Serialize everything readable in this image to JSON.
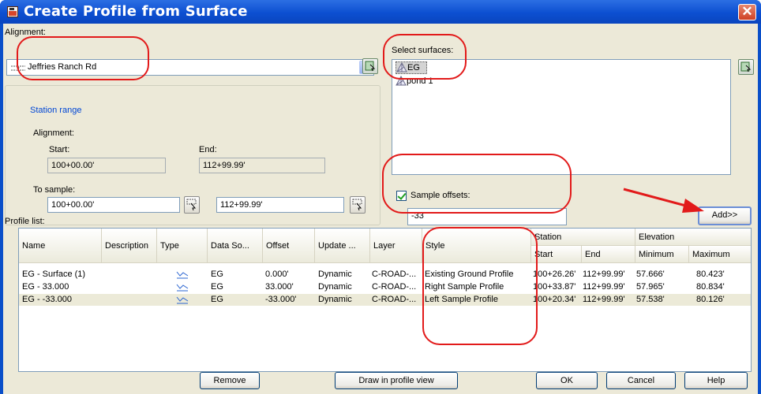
{
  "dialog": {
    "title": "Create Profile from Surface",
    "close_glyph": "✕"
  },
  "alignment": {
    "label": "Alignment:",
    "selected": "Jeffries Ranch Rd",
    "icon": "alignment-line-icon"
  },
  "station_range": {
    "title": "Station range",
    "alignment_label": "Alignment:",
    "start_label": "Start:",
    "end_label": "End:",
    "start_value": "100+00.00'",
    "end_value": "112+99.99'",
    "to_sample_label": "To sample:",
    "sample_start": "100+00.00'",
    "sample_end": "112+99.99'"
  },
  "surfaces": {
    "label": "Select surfaces:",
    "items": [
      {
        "name": "EG",
        "icon": "surface-icon",
        "selected": true
      },
      {
        "name": "pond 1",
        "icon": "surface-icon",
        "selected": false
      }
    ]
  },
  "sample_offsets": {
    "label": "Sample offsets:",
    "checked": true,
    "value": "-33"
  },
  "buttons": {
    "add": "Add>>",
    "remove": "Remove",
    "draw_in_profile_view": "Draw in profile view",
    "ok": "OK",
    "cancel": "Cancel",
    "help": "Help"
  },
  "profile_list": {
    "label": "Profile list:",
    "columns": {
      "name": "Name",
      "description": "Description",
      "type": "Type",
      "data_source": "Data So...",
      "offset": "Offset",
      "update": "Update ...",
      "layer": "Layer",
      "style": "Style",
      "station": "Station",
      "station_start": "Start",
      "station_end": "End",
      "elevation": "Elevation",
      "elevation_min": "Minimum",
      "elevation_max": "Maximum"
    },
    "rows": [
      {
        "name": "EG - Surface (1)",
        "description": "",
        "type_icon": "profile-type-icon",
        "data_source": "EG",
        "offset": "0.000'",
        "update": "Dynamic",
        "layer": "C-ROAD-...",
        "style": "Existing Ground Profile",
        "start": "100+26.26'",
        "end": "112+99.99'",
        "minimum": "57.666'",
        "maximum": "80.423'"
      },
      {
        "name": "EG - 33.000",
        "description": "",
        "type_icon": "profile-type-icon",
        "data_source": "EG",
        "offset": "33.000'",
        "update": "Dynamic",
        "layer": "C-ROAD-...",
        "style": "Right Sample Profile",
        "start": "100+33.87'",
        "end": "112+99.99'",
        "minimum": "57.965'",
        "maximum": "80.834'"
      },
      {
        "name": "EG - -33.000",
        "description": "",
        "type_icon": "profile-type-icon",
        "data_source": "EG",
        "offset": "-33.000'",
        "update": "Dynamic",
        "layer": "C-ROAD-...",
        "style": "Left Sample Profile",
        "start": "100+20.34'",
        "end": "112+99.99'",
        "minimum": "57.538'",
        "maximum": "80.126'"
      }
    ]
  },
  "colors": {
    "titlebar": "#0c4fd1",
    "dialog_face": "#ece9d8",
    "annotation_red": "#e21a1a",
    "group_title_blue": "#0046d5"
  }
}
